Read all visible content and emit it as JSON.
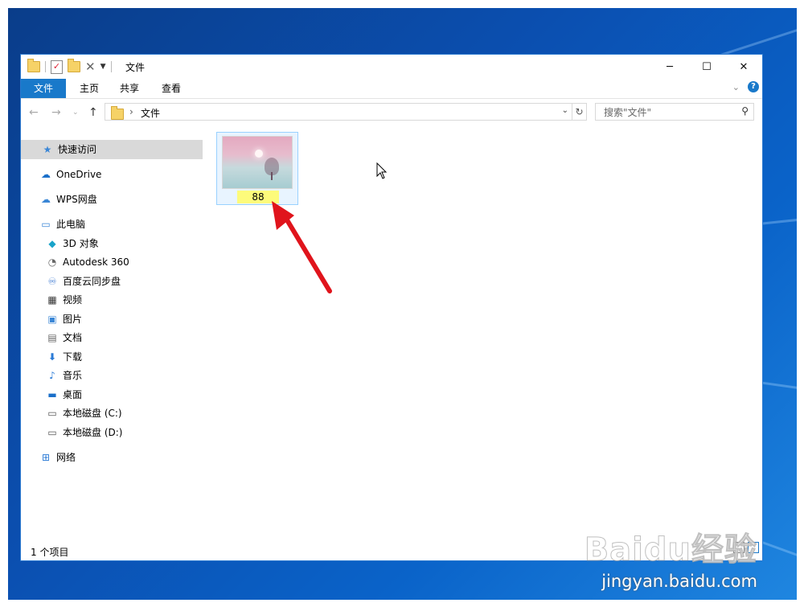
{
  "window": {
    "title": "文件",
    "controls": {
      "minimize": "─",
      "maximize": "☐",
      "close": "✕"
    }
  },
  "ribbon": {
    "tabs": [
      "文件",
      "主页",
      "共享",
      "查看"
    ],
    "help": "?"
  },
  "address": {
    "path": "文件",
    "separator": "›",
    "refresh": "↻"
  },
  "search": {
    "placeholder": "搜索\"文件\""
  },
  "nav": {
    "quick_access": "快速访问",
    "onedrive": "OneDrive",
    "wps": "WPS网盘",
    "this_pc": "此电脑",
    "pc_items": [
      "3D 对象",
      "Autodesk 360",
      "百度云同步盘",
      "视频",
      "图片",
      "文档",
      "下载",
      "音乐",
      "桌面",
      "本地磁盘 (C:)",
      "本地磁盘 (D:)"
    ],
    "network": "网络"
  },
  "files": [
    {
      "name": "88"
    }
  ],
  "status": {
    "item_count": "1 个项目"
  },
  "watermark": {
    "logo": "Baidu经验",
    "url": "jingyan.baidu.com"
  },
  "colors": {
    "accent": "#1979ca",
    "arrow": "#e0141c",
    "rename_highlight": "#fdfb7b"
  }
}
